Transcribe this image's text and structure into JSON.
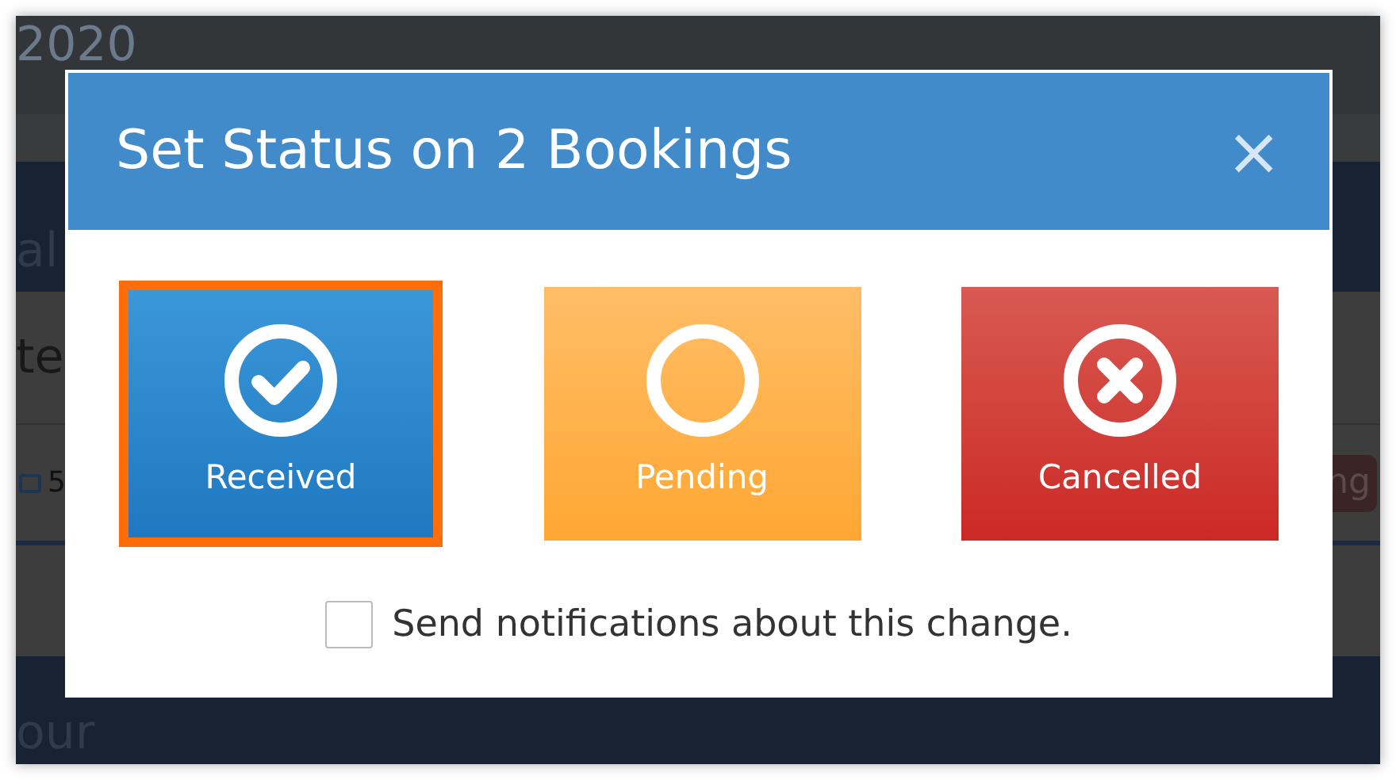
{
  "background": {
    "header_text": "2020",
    "section_text": "al",
    "row_1_text": "te",
    "row_2_count": "5",
    "row_2_badge": "ng",
    "footer_text": "our"
  },
  "dialog": {
    "title": "Set Status on 2 Bookings",
    "close": "×",
    "statuses": [
      {
        "kind": "received",
        "label": "Received",
        "selected": true
      },
      {
        "kind": "pending",
        "label": "Pending",
        "selected": false
      },
      {
        "kind": "cancelled",
        "label": "Cancelled",
        "selected": false
      }
    ],
    "notify": {
      "label": "Send notifications about this change.",
      "checked": false
    }
  }
}
